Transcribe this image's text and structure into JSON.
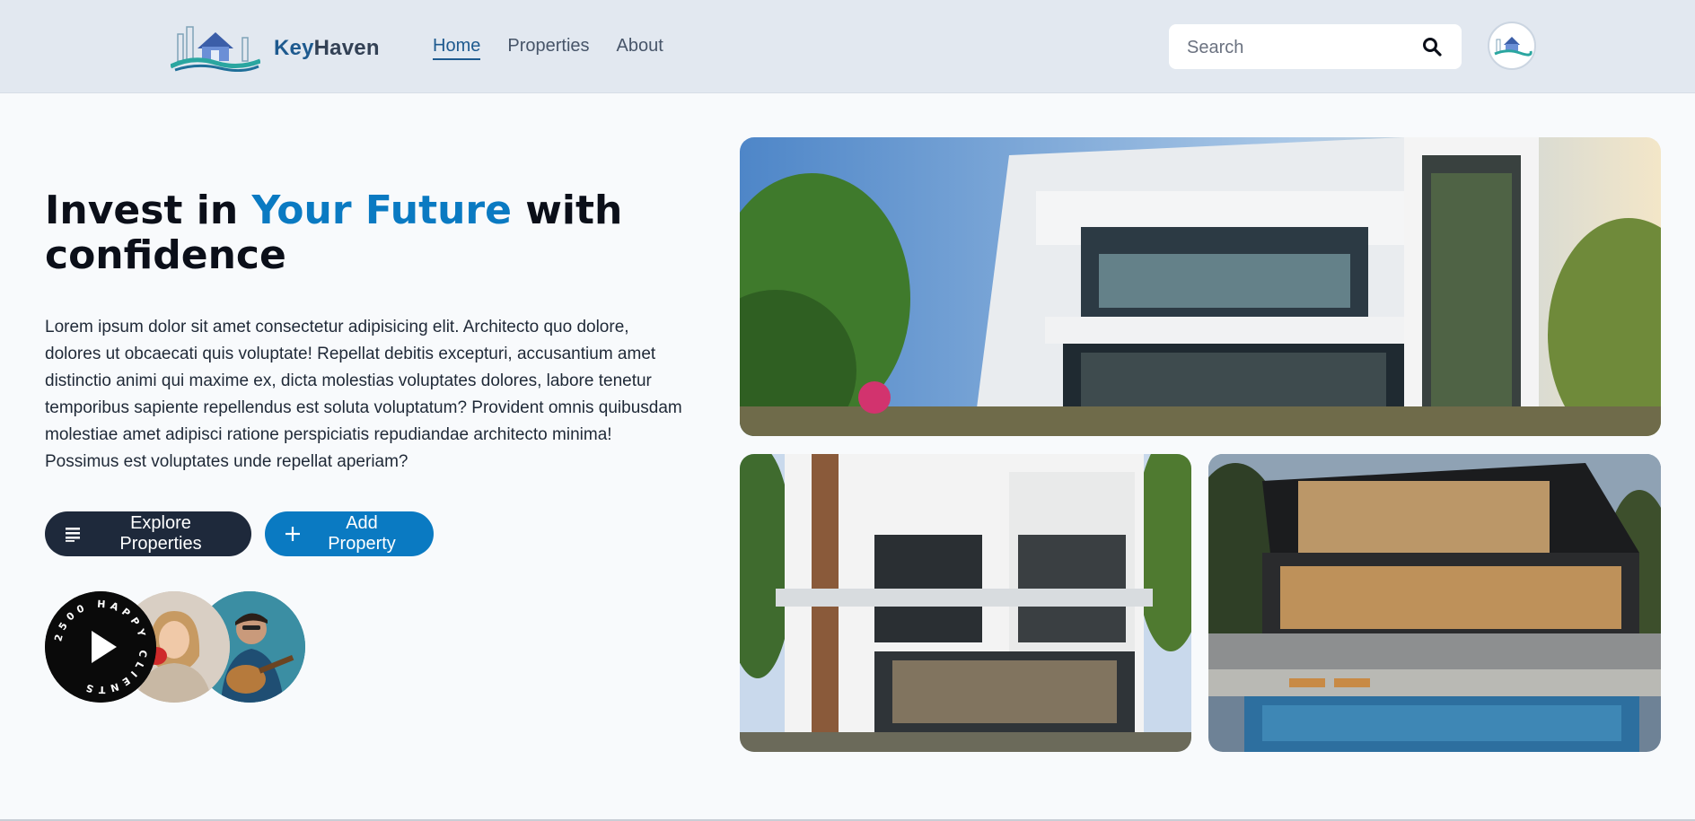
{
  "header": {
    "brand_prefix": "Key",
    "brand_suffix": "Haven",
    "nav": [
      {
        "label": "Home",
        "active": true
      },
      {
        "label": "Properties",
        "active": false
      },
      {
        "label": "About",
        "active": false
      }
    ],
    "search_placeholder": "Search",
    "search_icon": "search-icon"
  },
  "hero": {
    "title_part1": "Invest in ",
    "title_accent": "Your Future",
    "title_part2": " with confidence",
    "description": "Lorem ipsum dolor sit amet consectetur adipisicing elit. Architecto quo dolore, dolores ut obcaecati quis voluptate! Repellat debitis excepturi, accusantium amet distinctio animi qui maxime ex, dicta molestias voluptates dolores, labore tenetur temporibus sapiente repellendus est soluta voluptatum? Provident omnis quibusdam molestiae amet adipisci ratione perspiciatis repudiandae architecto minima! Possimus est voluptates unde repellat aperiam?",
    "explore_label": "Explore Properties",
    "explore_icon": "list-icon",
    "add_label": "Add Property",
    "add_icon": "plus-icon",
    "clients_badge": "2500 HAPPY CLIENTS"
  },
  "colors": {
    "accent": "#0a7ac2",
    "brand": "#1e5a8f",
    "dark_button": "#1e293b",
    "header_bg": "#e2e8f0",
    "page_bg": "#f8fafc"
  }
}
